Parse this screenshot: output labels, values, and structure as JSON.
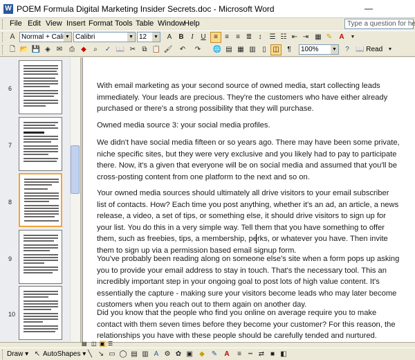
{
  "window": {
    "title": "POEM Formula Digital Marketing Insider Secrets.doc - Microsoft Word",
    "app_icon": "W",
    "minimize_glyph": "—"
  },
  "menu": {
    "items": [
      "File",
      "Edit",
      "View",
      "Insert",
      "Format",
      "Tools",
      "Table",
      "Window",
      "Help"
    ],
    "help_placeholder": "Type a question for help"
  },
  "formatting": {
    "style": "Normal + Calibri",
    "font": "Calibri",
    "size": "12",
    "bold": "B",
    "italic": "I",
    "underline": "U",
    "zoom": "100%",
    "read_label": "Read"
  },
  "pages": [
    {
      "number": "6"
    },
    {
      "number": "7"
    },
    {
      "number": "8",
      "selected": true
    },
    {
      "number": "9"
    },
    {
      "number": "10"
    }
  ],
  "document": {
    "paragraphs": [
      [
        "With email marketing as your second source of owned media, start collecting leads",
        "immediately. Your leads are precious. They're the customers who have either already",
        "purchased or there's a strong possibility that they will purchase."
      ],
      [
        "Owned media source 3: your social media profiles."
      ],
      [
        "We didn't have social media fifteen or so years ago. There may have been some private,",
        "niche specific sites, but they were very exclusive and you likely had to pay to participate",
        "there. Now, it's a given that everyone will be on social media and assumed that you'll be",
        "cross-posting content from one platform to the next and so on."
      ],
      [
        "Your owned media sources should ultimately all drive visitors to your email subscriber",
        "list of contacts. How? Each time you post anything, whether it's an ad, an article, a news",
        "release, a video, a set of tips, or something else, it should drive visitors to sign up for",
        "your list. You do this in a very simple way. Tell them that you have something to offer",
        "them, such as freebies, tips, a membership, perks, or whatever you have. Then invite",
        "them to sign up via a permission based email signup form."
      ],
      [
        "You've probably been reading along on someone else's site when a form pops up asking",
        "you to provide your email address to stay in touch. That's the necessary tool. This an",
        "incredibly important step in your ongoing goal to post lots of high value content. It's",
        "essentially the capture - making sure your visitors become leads who may later become",
        "customers when you reach out to them again on another day."
      ],
      [
        "Did you know that the people who find you online on average require you to make",
        "contact with them seven times before they become your customer? For this reason, the",
        "relationships you have with these people should be carefully tended and nurtured."
      ]
    ]
  },
  "drawing": {
    "draw_label": "Draw",
    "autoshapes_label": "AutoShapes"
  }
}
